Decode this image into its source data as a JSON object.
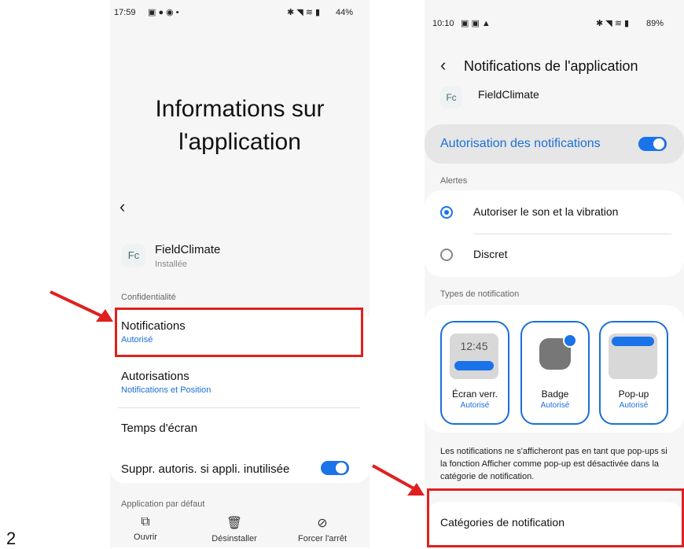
{
  "page_number": "2",
  "left": {
    "status_time": "17:59",
    "status_right": "44%",
    "title_line1": "Informations sur",
    "title_line2": "l'application",
    "app_name": "FieldClimate",
    "app_status": "Installée",
    "section_privacy": "Confidentialité",
    "notifications_label": "Notifications",
    "notifications_sub": "Autorisé",
    "permissions_label": "Autorisations",
    "permissions_sub": "Notifications et Position",
    "screen_time_label": "Temps d'écran",
    "suppress_label": "Suppr. autoris. si appli. inutilisée",
    "section_default": "Application par défaut",
    "actions": [
      {
        "label": "Ouvrir",
        "icon": "open-external-icon"
      },
      {
        "label": "Désinstaller",
        "icon": "trash-icon"
      },
      {
        "label": "Forcer l'arrêt",
        "icon": "stop-icon"
      }
    ]
  },
  "right": {
    "status_time": "10:10",
    "status_right": "89%",
    "header_title": "Notifications de l'application",
    "app_name": "FieldClimate",
    "allow_label": "Autorisation des notifications",
    "alerts_header": "Alertes",
    "alert_options": [
      "Autoriser le son et la vibration",
      "Discret"
    ],
    "types_header": "Types de notification",
    "lock_time": "12:45",
    "tiles": [
      {
        "label": "Écran verr.",
        "status": "Autorisé"
      },
      {
        "label": "Badge",
        "status": "Autorisé"
      },
      {
        "label": "Pop-up",
        "status": "Autorisé"
      }
    ],
    "info_text": "Les notifications ne s'afficheront pas en tant que pop-ups si la fonction Afficher comme pop-up est désactivée dans la catégorie de notification.",
    "categories_label": "Catégories de notification"
  },
  "colors": {
    "accent": "#1a73e8",
    "annotation_red": "#e02020"
  }
}
